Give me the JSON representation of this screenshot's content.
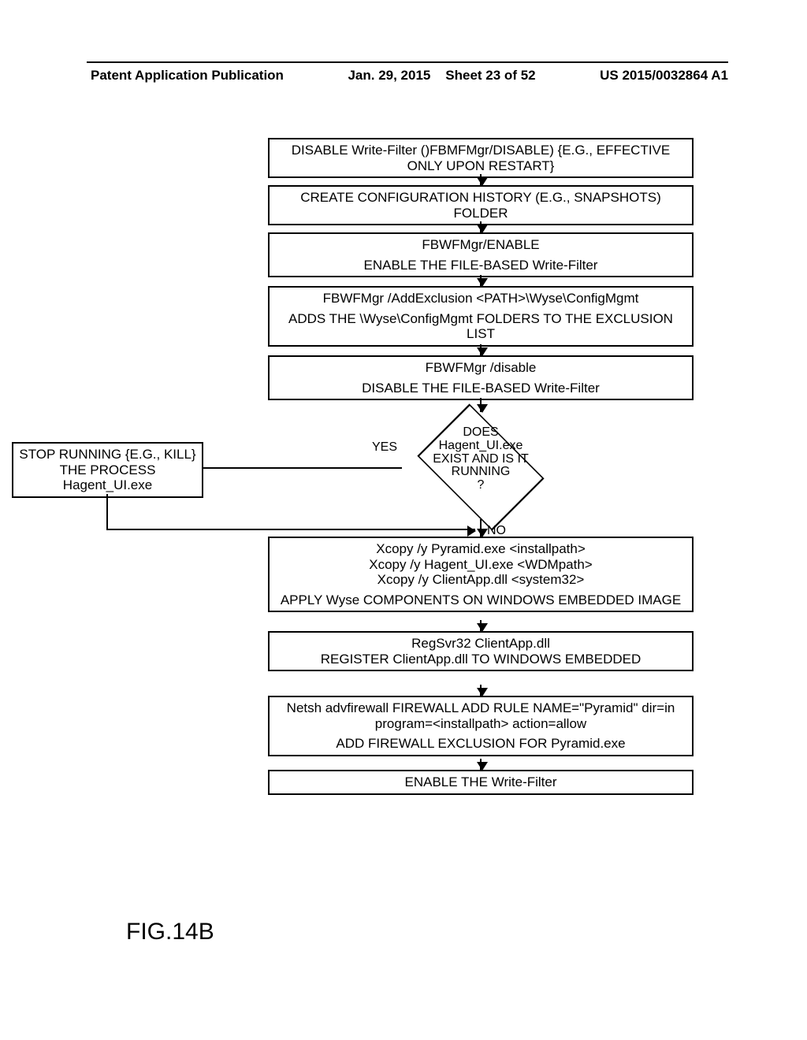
{
  "header": {
    "pubtype": "Patent Application Publication",
    "date": "Jan. 29, 2015",
    "sheet": "Sheet 23 of 52",
    "pubno": "US 2015/0032864 A1"
  },
  "figure_label": "FIG.14B",
  "boxes": {
    "b1": "DISABLE Write-Filter ()FBMFMgr/DISABLE) {E.G., EFFECTIVE ONLY UPON RESTART}",
    "b2": "CREATE CONFIGURATION HISTORY (E.G., SNAPSHOTS) FOLDER",
    "b3a": "FBWFMgr/ENABLE",
    "b3b": "ENABLE THE FILE-BASED Write-Filter",
    "b4a": "FBWFMgr /AddExclusion <PATH>\\Wyse\\ConfigMgmt",
    "b4b": "ADDS THE \\Wyse\\ConfigMgmt FOLDERS TO THE EXCLUSION LIST",
    "b5a": "FBWFMgr /disable",
    "b5b": "DISABLE THE FILE-BASED Write-Filter",
    "b6a": "Xcopy /y Pyramid.exe <installpath>",
    "b6b": "Xcopy /y Hagent_UI.exe <WDMpath>",
    "b6c": "Xcopy /y ClientApp.dll <system32>",
    "b6d": "APPLY Wyse COMPONENTS ON WINDOWS EMBEDDED IMAGE",
    "b7a": "RegSvr32 ClientApp.dll",
    "b7b": "REGISTER ClientApp.dll TO WINDOWS EMBEDDED",
    "b8a": "Netsh advfirewall FIREWALL ADD RULE NAME=\"Pyramid\" dir=in program=<installpath> action=allow",
    "b8b": "ADD FIREWALL EXCLUSION FOR Pyramid.exe",
    "b9": "ENABLE THE Write-Filter"
  },
  "decision": {
    "line1": "DOES",
    "line2": "Hagent_UI.exe",
    "line3": "EXIST AND IS IT",
    "line4": "RUNNING",
    "line5": "?",
    "yes": "YES",
    "no": "NO"
  },
  "side": {
    "line1": "STOP RUNNING {E.G., KILL}",
    "line2": "THE PROCESS",
    "line3": "Hagent_UI.exe"
  }
}
